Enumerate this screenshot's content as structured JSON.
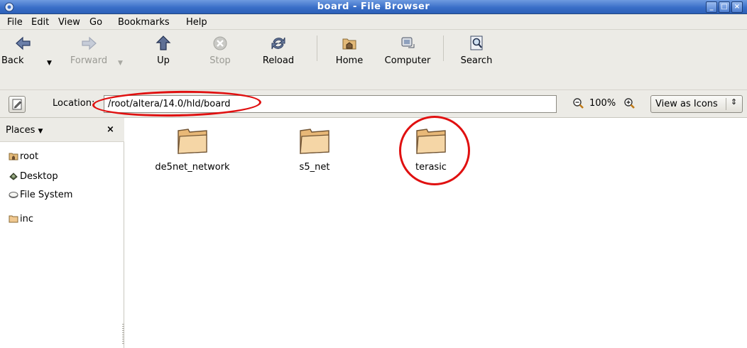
{
  "window": {
    "title": "board - File Browser"
  },
  "menu": [
    "File",
    "Edit",
    "View",
    "Go",
    "Bookmarks",
    "Help"
  ],
  "toolbar": {
    "back": "Back",
    "forward": "Forward",
    "up": "Up",
    "stop": "Stop",
    "reload": "Reload",
    "home": "Home",
    "computer": "Computer",
    "search": "Search"
  },
  "location": {
    "label": "Location:",
    "path": "/root/altera/14.0/hld/board",
    "zoom": "100%",
    "view_mode": "View as Icons"
  },
  "sidebar": {
    "title": "Places",
    "items": [
      {
        "label": "root",
        "icon": "home-folder-icon"
      },
      {
        "label": "Desktop",
        "icon": "desktop-icon"
      },
      {
        "label": "File System",
        "icon": "drive-icon"
      },
      {
        "label": "inc",
        "icon": "folder-icon"
      }
    ]
  },
  "files": [
    {
      "name": "de5net_network",
      "icon": "folder-icon"
    },
    {
      "name": "s5_net",
      "icon": "folder-icon"
    },
    {
      "name": "terasic",
      "icon": "folder-icon"
    }
  ],
  "colors": {
    "titlebar": "#3a6fc8",
    "chrome": "#ecebe6",
    "annotation": "#e01010",
    "folder": "#f0c890"
  }
}
